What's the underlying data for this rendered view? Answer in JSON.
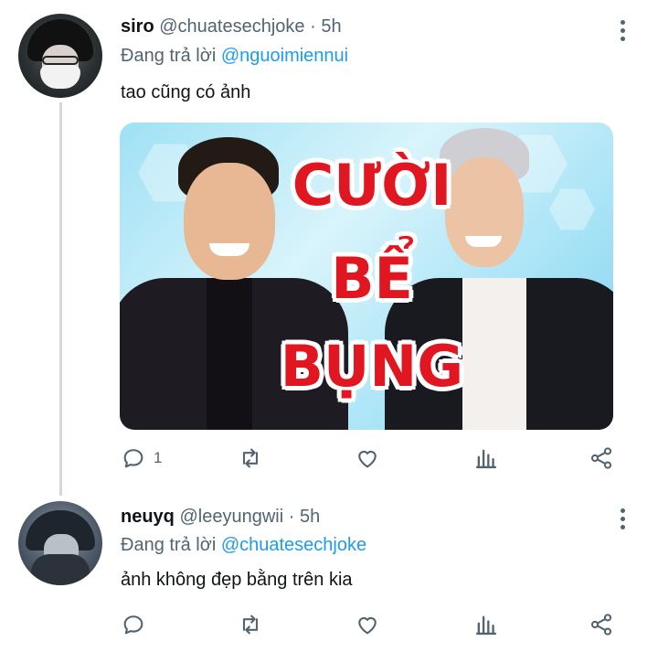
{
  "tweets": [
    {
      "display_name": "siro",
      "handle": "@chuatesechjoke",
      "separator": " · ",
      "time": "5h",
      "replying_prefix": "Đang trả lời ",
      "replying_to": "@nguoimiennui",
      "text": "tao cũng có ảnh",
      "media": {
        "thumbnail_lines": [
          "CƯỜI",
          "BỂ",
          "BỤNG"
        ]
      },
      "actions": {
        "reply_count": "1",
        "retweet_count": "",
        "like_count": ""
      }
    },
    {
      "display_name": "neuyq",
      "handle": "@leeyungwii",
      "separator": " · ",
      "time": "5h",
      "replying_prefix": "Đang trả lời ",
      "replying_to": "@chuatesechjoke",
      "text": "ảnh không đẹp bằng trên kia",
      "actions": {
        "reply_count": "",
        "retweet_count": "",
        "like_count": ""
      }
    }
  ],
  "icons": {
    "reply": "reply-icon",
    "retweet": "retweet-icon",
    "like": "like-icon",
    "analytics": "analytics-icon",
    "share": "share-icon",
    "more": "more-options-icon"
  },
  "colors": {
    "link": "#1d9bf0",
    "secondary_text": "#536471",
    "thread_line": "#cfd9de",
    "thumbnail_title": "#e01620"
  }
}
